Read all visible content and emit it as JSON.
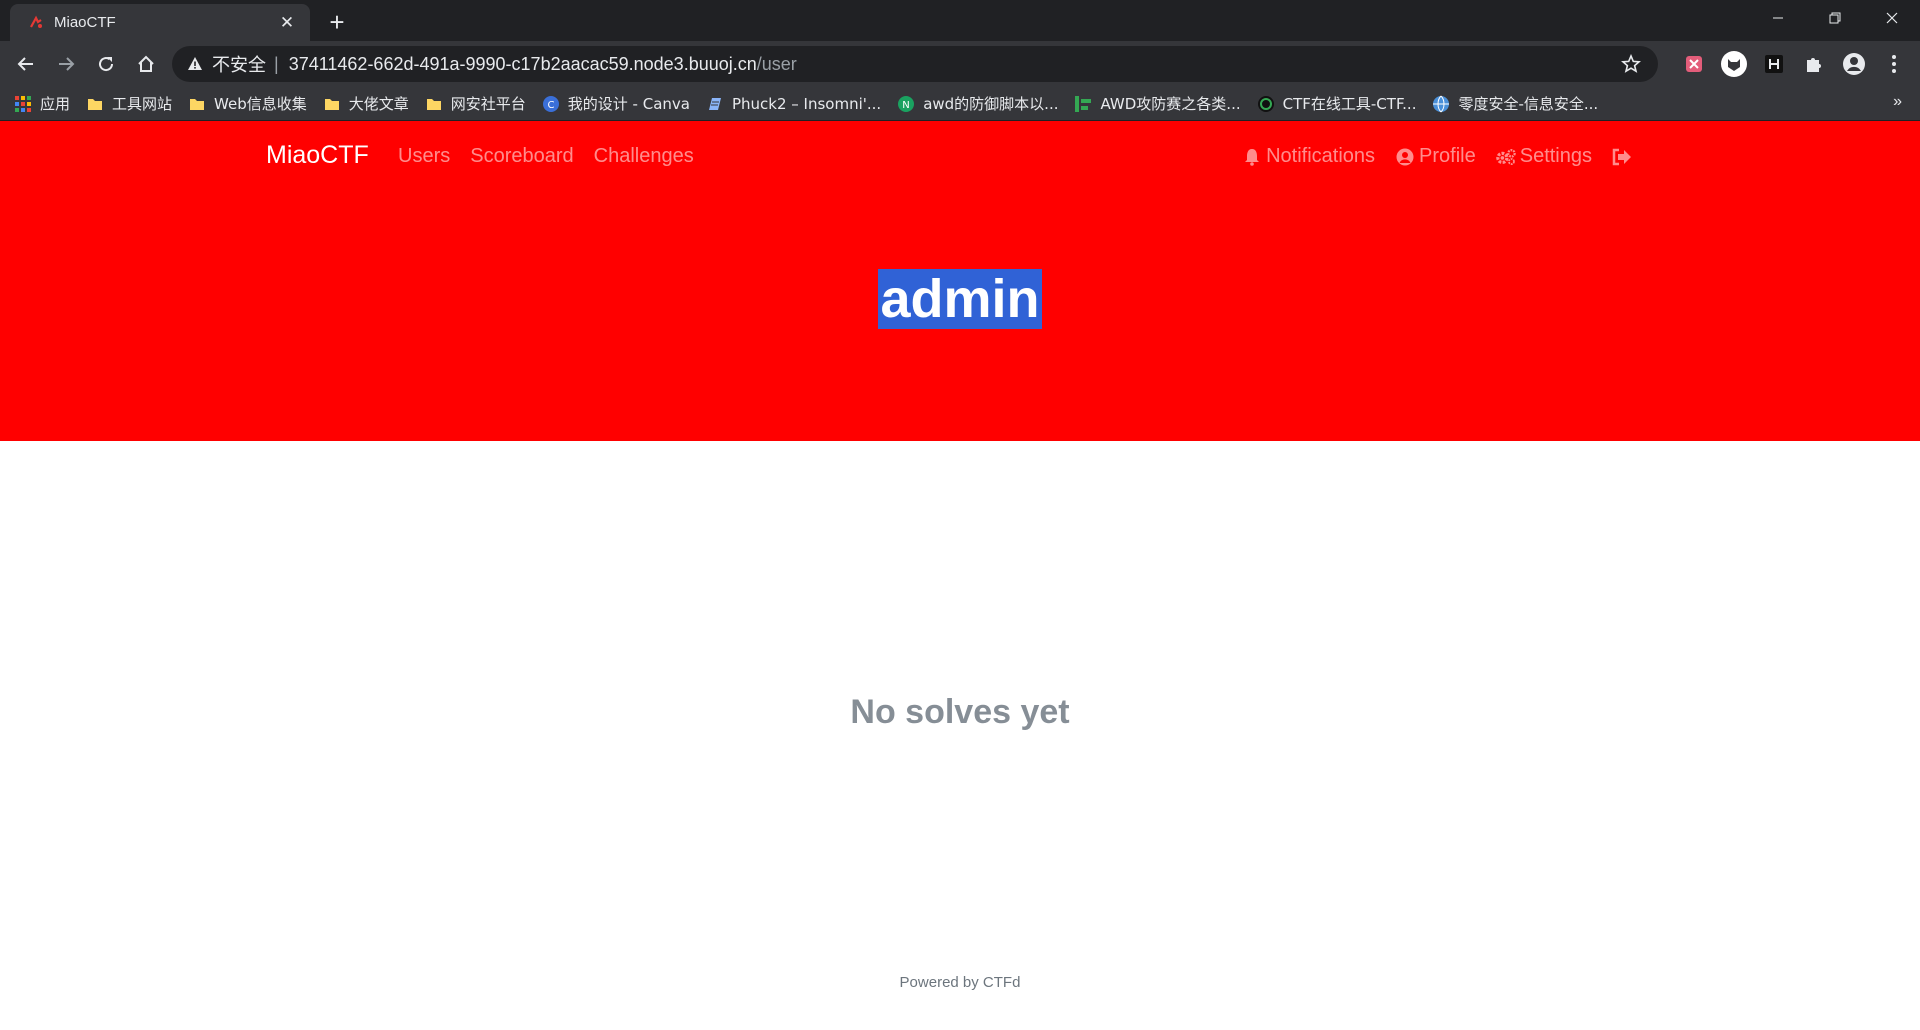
{
  "browser": {
    "tab_title": "MiaoCTF",
    "new_tab_symbol": "+",
    "omnibox": {
      "insecure_label": "不安全",
      "separator": "|",
      "host": "37411462-662d-491a-9990-c17b2aacac59.node3.buuoj.cn",
      "path": "/user"
    },
    "bookmarks": [
      {
        "label": "应用",
        "icon": "apps-grid-icon"
      },
      {
        "label": "工具网站",
        "icon": "folder-icon"
      },
      {
        "label": "Web信息收集",
        "icon": "folder-icon"
      },
      {
        "label": "大佬文章",
        "icon": "folder-icon"
      },
      {
        "label": "网安社平台",
        "icon": "folder-icon"
      },
      {
        "label": "我的设计 - Canva",
        "icon": "canva-icon"
      },
      {
        "label": "Phuck2 – Insomni'...",
        "icon": "page-icon"
      },
      {
        "label": "awd的防御脚本以...",
        "icon": "n-circle-icon"
      },
      {
        "label": "AWD攻防赛之各类...",
        "icon": "bars-icon"
      },
      {
        "label": "CTF在线工具-CTF...",
        "icon": "ctf-circle-icon"
      },
      {
        "label": "零度安全-信息安全...",
        "icon": "globe-icon"
      }
    ],
    "bookmarks_more": "»"
  },
  "site": {
    "brand": "MiaoCTF",
    "nav_left": [
      "Users",
      "Scoreboard",
      "Challenges"
    ],
    "nav_right": {
      "notifications": "Notifications",
      "profile": "Profile",
      "settings": "Settings"
    },
    "user_name": "admin",
    "empty_message": "No solves yet",
    "footer": "Powered by CTFd",
    "colors": {
      "jumbotron": "#ff0000",
      "selection": "#3062d6"
    }
  }
}
